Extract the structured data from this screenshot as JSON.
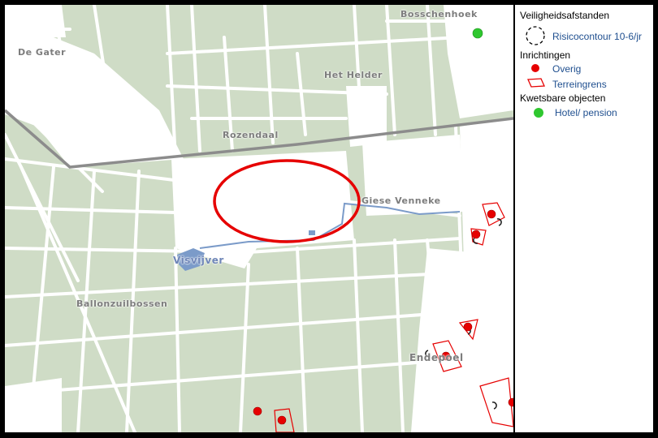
{
  "map": {
    "places": {
      "de_gater": "De Gater",
      "bosschenhoek": "Bosschenhoek",
      "het_helder": "Het Helder",
      "rozendaal": "Rozendaal",
      "giese_venneke": "Giese Venneke",
      "visvijver": "Visvijver",
      "ballonzuilbossen": "Ballonzuilbossen",
      "endepoel": "Endepoel"
    },
    "colors": {
      "forest": "#cfdcc6",
      "open": "#ffffff",
      "road": "#ffffff",
      "main_road": "#8c8c8c",
      "water": "#7b9bc9",
      "highlight": "#e60000",
      "inrichting": "#e60000",
      "kwetsbaar": "#2fc72f"
    }
  },
  "legend": {
    "veiligheidsafstanden": "Veiligheidsafstanden",
    "risicocontour": "Risicocontour 10-6/jr",
    "inrichtingen": "Inrichtingen",
    "overig": "Overig",
    "terreingrens": "Terreingrens",
    "kwetsbare_objecten": "Kwetsbare objecten",
    "hotel_pension": "Hotel/ pension"
  }
}
